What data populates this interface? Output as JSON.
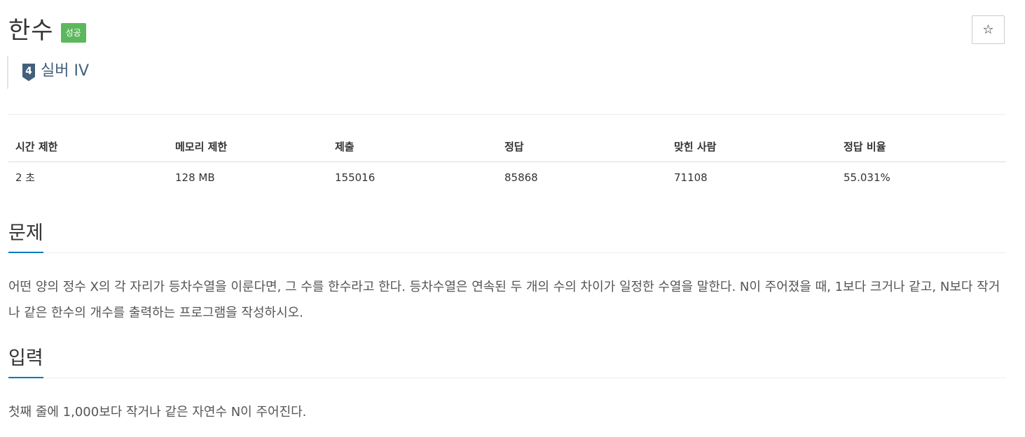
{
  "problem": {
    "title": "한수",
    "status": "성공",
    "star_icon": "star-outline-icon",
    "tier": {
      "number": "4",
      "label": "실버 IV",
      "color": "#435f7a"
    }
  },
  "info_table": {
    "headers": [
      "시간 제한",
      "메모리 제한",
      "제출",
      "정답",
      "맞힌 사람",
      "정답 비율"
    ],
    "values": [
      "2 초",
      "128 MB",
      "155016",
      "85868",
      "71108",
      "55.031%"
    ]
  },
  "sections": {
    "description": {
      "heading": "문제",
      "text": "어떤 양의 정수 X의 각 자리가 등차수열을 이룬다면, 그 수를 한수라고 한다. 등차수열은 연속된 두 개의 수의 차이가 일정한 수열을 말한다. N이 주어졌을 때, 1보다 크거나 같고, N보다 작거나 같은 한수의 개수를 출력하는 프로그램을 작성하시오."
    },
    "input": {
      "heading": "입력",
      "text": "첫째 줄에 1,000보다 작거나 같은 자연수 N이 주어진다."
    }
  },
  "colors": {
    "success": "#5cb85c",
    "accent": "#0076c0"
  }
}
